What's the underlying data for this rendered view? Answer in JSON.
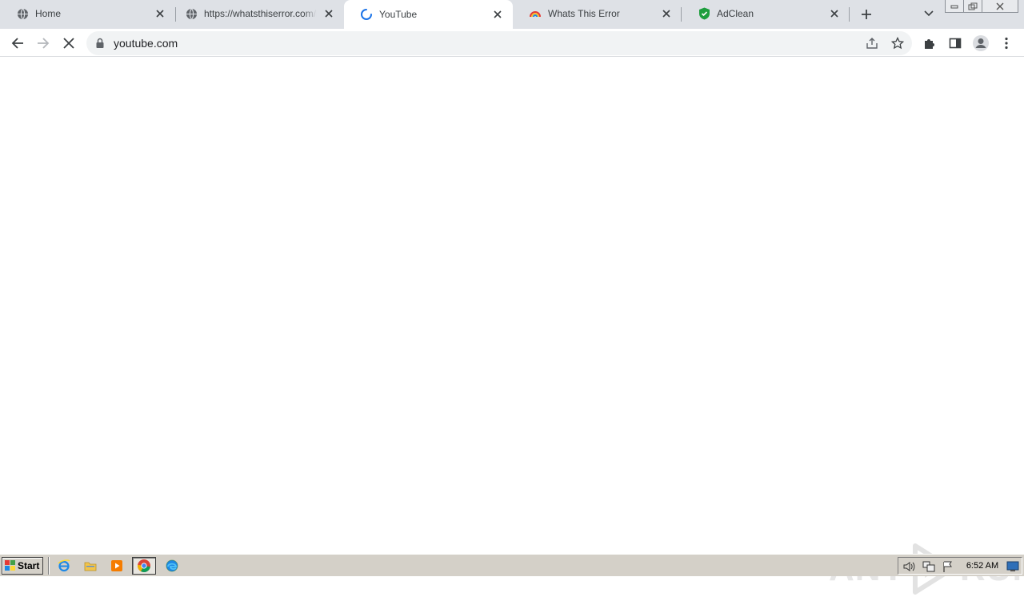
{
  "browser": {
    "tabs": [
      {
        "title": "Home",
        "favicon": "globe-icon",
        "active": false
      },
      {
        "title": "https://whatsthiserror.com/lar",
        "favicon": "globe-icon",
        "active": false
      },
      {
        "title": "YouTube",
        "favicon": "loading-spinner-icon",
        "active": true
      },
      {
        "title": "Whats This Error",
        "favicon": "rainbow-icon",
        "active": false
      },
      {
        "title": "AdClean",
        "favicon": "green-shield-icon",
        "active": false
      }
    ],
    "address": {
      "url": "youtube.com"
    },
    "colors": {
      "tabstrip_bg": "#dee1e6",
      "omnibox_bg": "#f1f3f4",
      "spinner": "#1a73e8",
      "adclean_green": "#1e9e3e"
    }
  },
  "watermark": {
    "left": "ANY",
    "right": "RUN"
  },
  "taskbar": {
    "start_label": "Start",
    "apps": [
      "internet-explorer-icon",
      "file-explorer-icon",
      "media-player-icon",
      "chrome-icon",
      "edge-icon"
    ],
    "active_app": "chrome-icon",
    "tray_icons": [
      "volume-icon",
      "network-icon",
      "action-center-flag-icon"
    ],
    "clock": "6:52 AM"
  }
}
